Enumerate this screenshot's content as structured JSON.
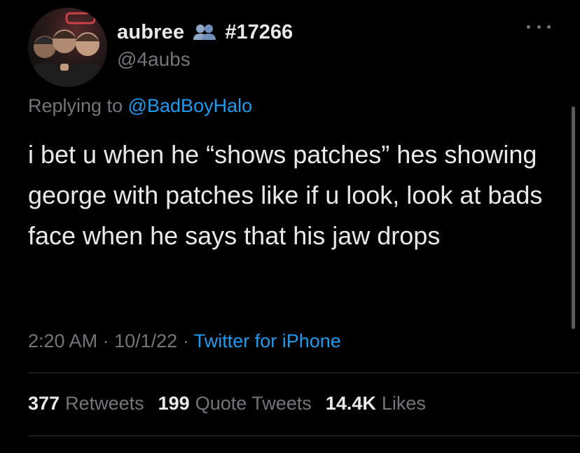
{
  "tweet": {
    "author": {
      "display_name": "aubree",
      "tag": "#17266",
      "handle": "@4aubs",
      "badge_icon": "group-icon"
    },
    "reply": {
      "prefix": "Replying to",
      "mention": "@BadBoyHalo"
    },
    "text": "i bet u when he “shows patches” hes showing george with patches like if u look, look at bads face when he says that his jaw drops",
    "meta": {
      "time": "2:20 AM",
      "separator": "·",
      "date": "10/1/22",
      "source": "Twitter for iPhone"
    },
    "stats": {
      "retweets_count": "377",
      "retweets_label": "Retweets",
      "quotes_count": "199",
      "quotes_label": "Quote Tweets",
      "likes_count": "14.4K",
      "likes_label": "Likes"
    }
  },
  "colors": {
    "background": "#000000",
    "text_primary": "#e7e9ea",
    "text_secondary": "#71767b",
    "accent": "#1d9bf0",
    "divider": "#2f3336"
  }
}
